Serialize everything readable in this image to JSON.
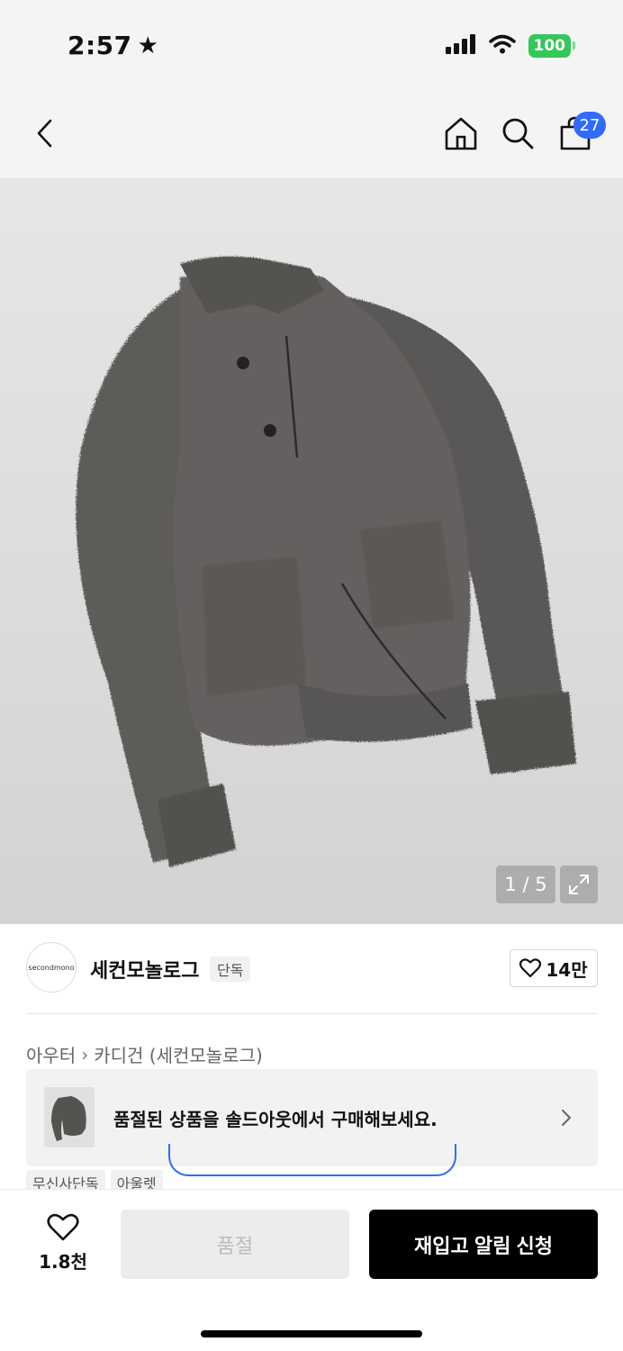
{
  "status_bar": {
    "time": "2:57",
    "battery": "100"
  },
  "nav": {
    "cart_count": "27"
  },
  "gallery": {
    "counter": "1 / 5"
  },
  "brand": {
    "logo_text": "secondmono",
    "name": "세컨모놀로그",
    "badge": "단독",
    "like_count": "14만"
  },
  "breadcrumb": {
    "items": [
      "아우터",
      "카디건 (세컨모놀로그)"
    ]
  },
  "soldout_banner": {
    "text": "품절된 상품을 솔드아웃에서 구매해보세요."
  },
  "tags": [
    "무신사단독",
    "아울렛"
  ],
  "bottom_bar": {
    "wish_count": "1.8천",
    "soldout_label": "품절",
    "restock_label": "재입고 알림 신청"
  },
  "colors": {
    "accent": "#2f6bff",
    "battery": "#34c759",
    "primary_button": "#000000"
  }
}
